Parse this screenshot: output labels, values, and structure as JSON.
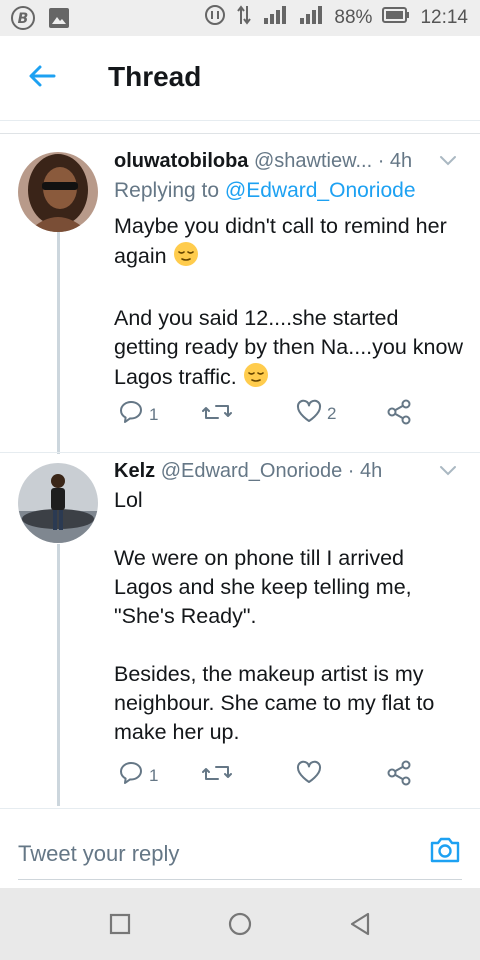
{
  "status": {
    "battery": "88%",
    "time": "12:14"
  },
  "header": {
    "title": "Thread"
  },
  "tweets": [
    {
      "name": "oluwatobiloba",
      "handle": "@shawtiew...",
      "time": "· 4h",
      "replying_label": "Replying to",
      "replying_to": "@Edward_Onoriode",
      "paragraphs": [
        "Maybe you didn't call to remind her again",
        "And you said 12....she started getting ready by then Na....you know Lagos traffic."
      ],
      "reply_count": "1",
      "like_count": "2"
    },
    {
      "name": "Kelz",
      "handle": "@Edward_Onoriode",
      "time": "· 4h",
      "paragraphs": [
        "Lol",
        "We were on phone till I arrived Lagos and she keep telling me, \"She's Ready\".",
        "Besides, the makeup artist is my neighbour. She came to my flat to make her up."
      ],
      "reply_count": "1",
      "like_count": ""
    }
  ],
  "reply_bar": {
    "placeholder": "Tweet your reply"
  },
  "colors": {
    "accent": "#1da1f2",
    "secondary_text": "#657786",
    "thread_line": "#ccd6dd"
  },
  "icons": {
    "status": [
      "b-app-icon",
      "gallery-icon",
      "data-saver-icon",
      "data-transfer-icon",
      "signal-icon",
      "signal-icon",
      "battery-icon"
    ],
    "tweet": [
      "reply-icon",
      "retweet-icon",
      "like-icon",
      "share-icon",
      "chevron-down-icon"
    ],
    "nav": [
      "recents-icon",
      "home-icon",
      "back-icon"
    ]
  }
}
